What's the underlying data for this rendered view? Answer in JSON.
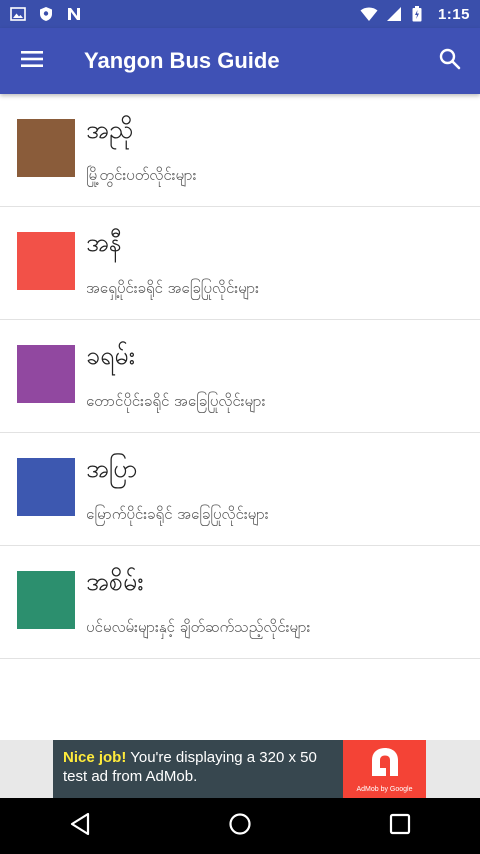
{
  "status_bar": {
    "time": "1:15",
    "icons": [
      "image-icon",
      "shield-icon",
      "n-icon",
      "wifi-icon",
      "signal-icon",
      "battery-icon"
    ]
  },
  "app_bar": {
    "title": "Yangon Bus Guide",
    "menu_icon": "menu-icon",
    "search_icon": "search-icon"
  },
  "routes": [
    {
      "name": "အညို",
      "description": "မြို့တွင်းပတ်လိုင်းများ",
      "color": "#8a5c3a"
    },
    {
      "name": "အနီ",
      "description": "အရှေ့ပိုင်းခရိုင် အခြေပြုလိုင်းများ",
      "color": "#f25148"
    },
    {
      "name": "ခရမ်း",
      "description": "တောင်ပိုင်းခရိုင် အခြေပြုလိုင်းများ",
      "color": "#9148a0"
    },
    {
      "name": "အပြာ",
      "description": "မြောက်ပိုင်းခရိုင် အခြေပြုလိုင်းများ",
      "color": "#3d58b0"
    },
    {
      "name": "အစိမ်း",
      "description": "ပင်မလမ်းများနှင့် ချိတ်ဆက်သည့်လိုင်းများ",
      "color": "#2c8f6e"
    }
  ],
  "ad": {
    "headline": "Nice job!",
    "body": " You're displaying a 320 x 50 test ad from AdMob.",
    "logo_caption": "AdMob by Google"
  },
  "nav_bar": {
    "icons": [
      "back-icon",
      "home-icon",
      "recents-icon"
    ]
  }
}
